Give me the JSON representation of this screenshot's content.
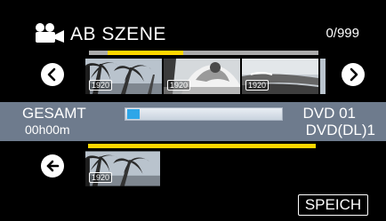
{
  "header": {
    "icon": "video-camera-icon",
    "title": "AB SZENE",
    "counter": "0/999"
  },
  "scrollbar": {
    "position_fraction": 0.08,
    "visible_fraction": 0.33
  },
  "scenes": {
    "visible": [
      {
        "badge": "1920",
        "icon": "palm-trees-scene"
      },
      {
        "badge": "1920",
        "icon": "beach-person-scene"
      },
      {
        "badge": "1920",
        "icon": "shoreline-scene"
      },
      {
        "badge": "19",
        "icon": "partial-scene"
      }
    ],
    "selected": [
      {
        "badge": "1920",
        "icon": "palm-trees-scene"
      }
    ]
  },
  "status": {
    "total_label": "GESAMT",
    "total_time": "00h00m",
    "progress_fraction": 0.08,
    "disc_line1": "DVD  01",
    "disc_line2": "DVD(DL)1"
  },
  "buttons": {
    "save_label": "SPEICH",
    "prev_icon": "chevron-left-icon",
    "next_icon": "chevron-right-icon",
    "back_icon": "arrow-left-icon"
  },
  "colors": {
    "accent_yellow": "#ffd700",
    "status_band": "#6e7b8d",
    "progress_fill": "#2ea6e8"
  }
}
